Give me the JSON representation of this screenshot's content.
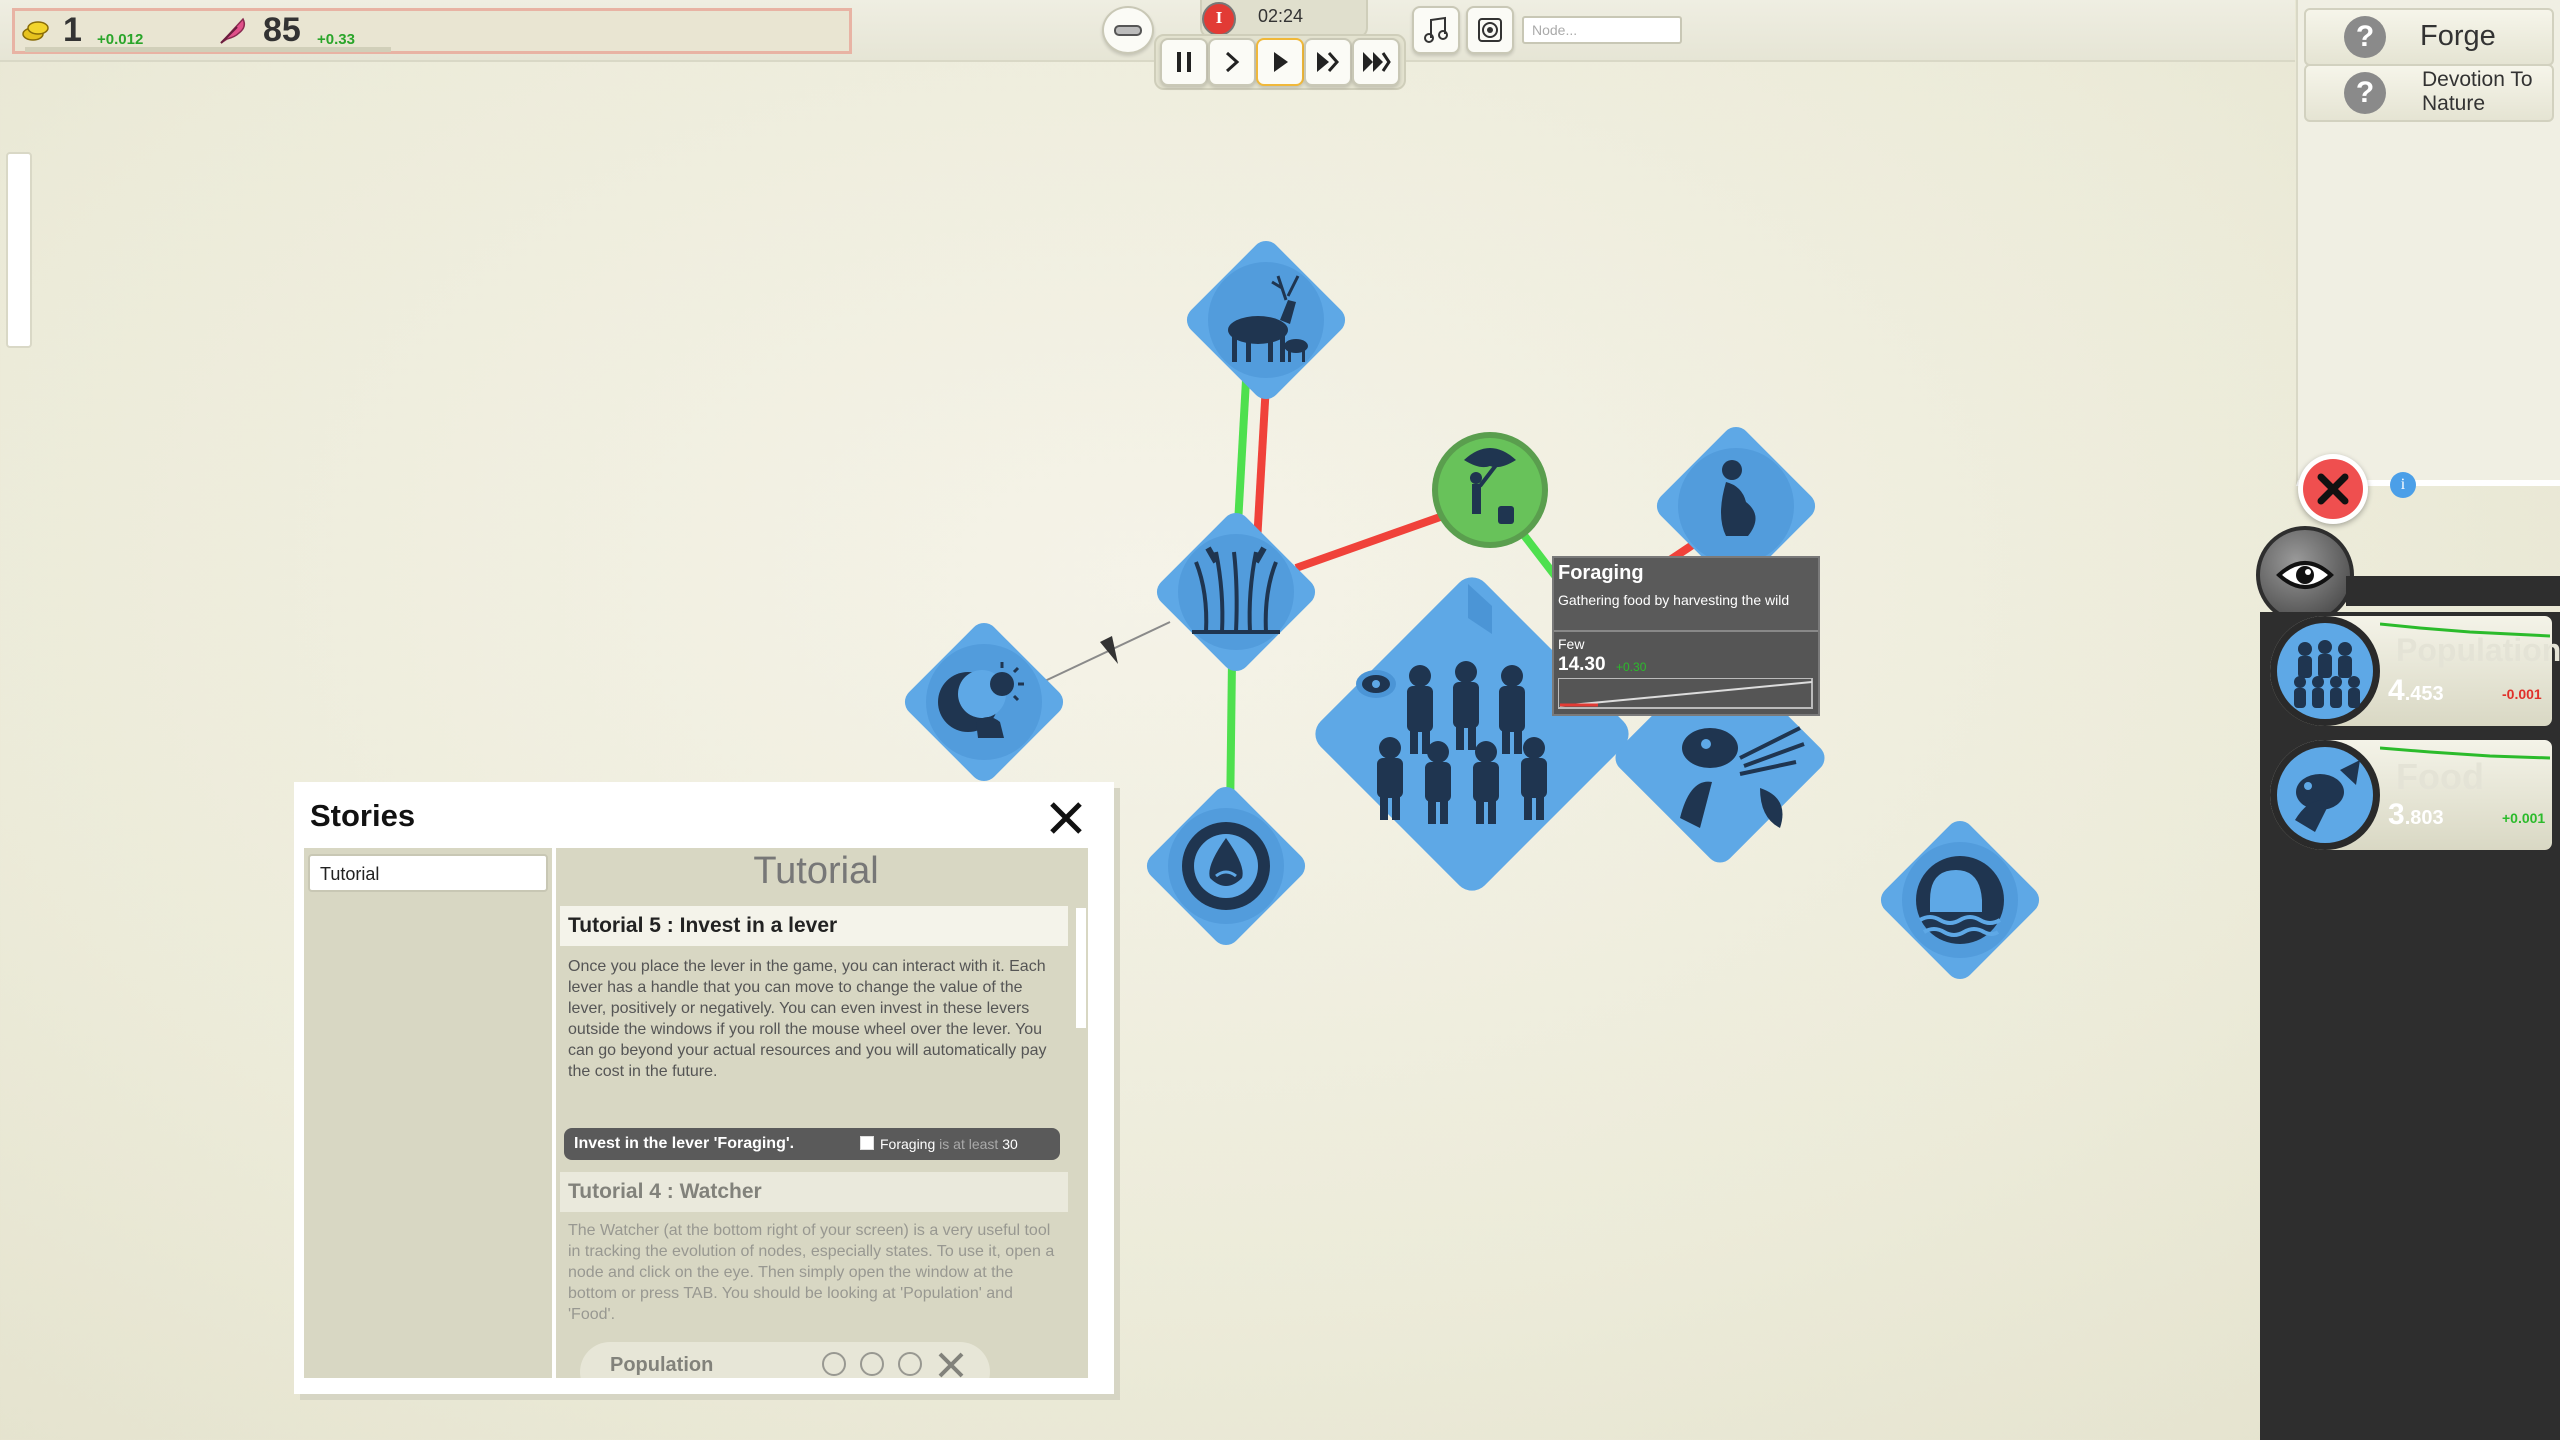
{
  "resources": [
    {
      "icon": "gold-coins-icon",
      "value": "1",
      "delta": "+0.012"
    },
    {
      "icon": "faith-feather-icon",
      "value": "85",
      "delta": "+0.33"
    }
  ],
  "time_controls": {
    "timer": "02:24",
    "alert_icon": "I",
    "speeds": [
      "pause",
      "play-slow",
      "play",
      "fast",
      "fastest"
    ]
  },
  "search": {
    "placeholder": "Node..."
  },
  "right_panel": {
    "items": [
      {
        "label": "Forge"
      },
      {
        "label": "Devotion To Nature"
      }
    ],
    "info_icon": "i"
  },
  "watcher": {
    "items": [
      {
        "label": "Population",
        "value_big": "4",
        "value_small": ".453",
        "delta": "-0.001",
        "delta_color": "#e0302a"
      },
      {
        "label": "Food",
        "value_big": "3",
        "value_small": ".803",
        "delta": "+0.001",
        "delta_color": "#2bbb2b"
      }
    ]
  },
  "tooltip": {
    "title": "Foraging",
    "description": "Gathering food by harvesting the wild",
    "level": "Few",
    "value": "14.30",
    "delta": "+0.30"
  },
  "stories": {
    "title": "Stories",
    "sidebar_items": [
      "Tutorial"
    ],
    "content_title": "Tutorial",
    "cards": [
      {
        "heading": "Tutorial 5 : Invest in a lever",
        "body": "Once you place the lever in the game, you can interact with it. Each lever has a handle that you can move to change the value of the lever, positively or negatively. You can even invest in these levers outside the windows if you roll the mouse wheel over the lever. You can go beyond your actual resources and you will automatically pay the cost in the future.",
        "objective": "Invest in the lever 'Foraging'.",
        "condition_a": "Foraging",
        "condition_b": "is at least",
        "condition_c": "30"
      },
      {
        "heading": "Tutorial 4 : Watcher",
        "body": "The Watcher (at the bottom right of your screen) is a very useful tool in tracking the evolution of nodes, especially states. To use it, open a node and click on the eye. Then simply open the window at the bottom or press TAB. You should be looking at 'Population' and 'Food'.",
        "preview_label": "Population"
      }
    ]
  },
  "colors": {
    "node_blue": "#5ea8e6",
    "node_dark": "#1f3550",
    "lever_green": "#68c25a",
    "link_red": "#f0423a",
    "link_green": "#4ee04e",
    "close_red": "#ef4f4f"
  }
}
